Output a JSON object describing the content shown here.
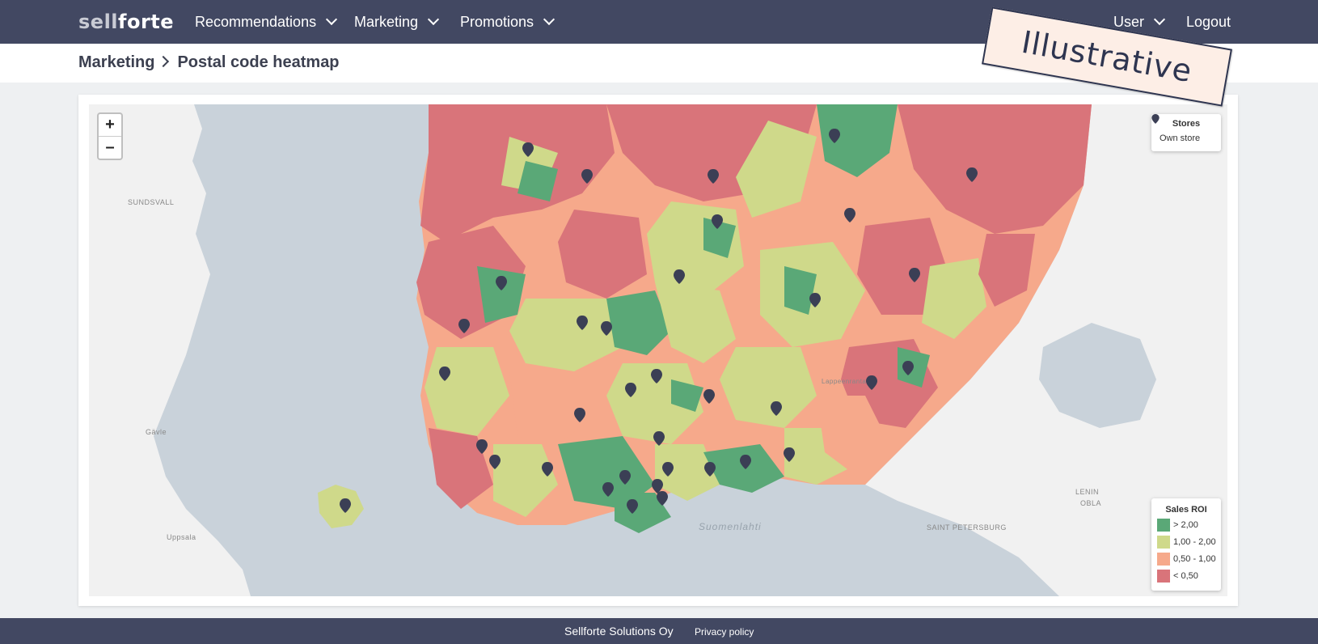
{
  "brand": {
    "logo_part1": "sell",
    "logo_part2": "forte"
  },
  "nav": {
    "items": [
      {
        "label": "Recommendations"
      },
      {
        "label": "Marketing"
      },
      {
        "label": "Promotions"
      }
    ],
    "user_label": "User",
    "logout_label": "Logout"
  },
  "breadcrumb": {
    "section": "Marketing",
    "page": "Postal code heatmap"
  },
  "map": {
    "zoom_in": "+",
    "zoom_out": "–",
    "places": [
      "SUNDSVALL",
      "Gävle",
      "Uppsala",
      "LENIN",
      "OBLA",
      "SAINT PETERSBURG",
      "Lappeenranta"
    ],
    "sea_label": "Suomenlahti",
    "stores_legend": {
      "title": "Stores",
      "own_store": "Own store"
    },
    "roi_legend": {
      "title": "Sales ROI",
      "items": [
        {
          "label": "> 2,00",
          "color": "#5aa877"
        },
        {
          "label": "1,00 - 2,00",
          "color": "#cfd98a"
        },
        {
          "label": "0,50 - 1,00",
          "color": "#f6a98b"
        },
        {
          "label": "< 0,50",
          "color": "#d9747a"
        }
      ]
    }
  },
  "watermark": "Illustrative",
  "footer": {
    "company": "Sellforte Solutions Oy",
    "privacy": "Privacy policy"
  },
  "colors": {
    "navbar": "#424862",
    "water": "#c9d2da",
    "land": "#f2f2f2",
    "pin": "#3b3f55"
  }
}
